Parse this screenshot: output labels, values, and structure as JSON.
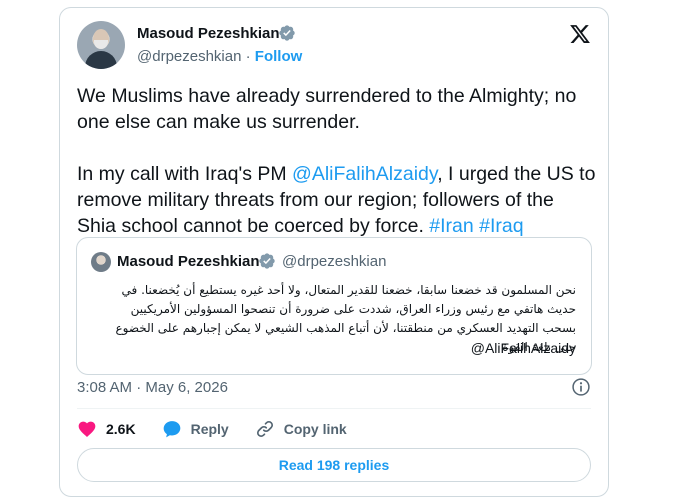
{
  "author": {
    "name": "Masoud Pezeshkian",
    "handle": "@drpezeshkian",
    "separator": "·",
    "follow_label": "Follow"
  },
  "tweet": {
    "paragraph1": "We Muslims have already surrendered to the Almighty; no one else can make us surrender.",
    "p2_before": "In my call with Iraq's PM ",
    "p2_mention": "@AliFalihAlzaidy",
    "p2_after": ", I urged the US to remove military threats from our region; followers of the Shia school cannot be coerced by force. ",
    "hashtag1": "#Iran",
    "hashtag2": "#Iraq"
  },
  "quote": {
    "name": "Masoud Pezeshkian",
    "handle": "@drpezeshkian",
    "text": "نحن المسلمون قد خضعنا سابقا، خضعنا للقدير المتعال، ولا أحد غيره يستطيع أن يُخضعنا. في حديث هاتفي مع رئيس وزراء العراق، شددت على ضرورة أن تنصحوا المسؤولين الأمريكيين بسحب التهديد العسكري من منطقتنا، لأن أتباع المذهب الشيعي لا يمكن إجبارهم على الخضوع حتى بلغة القوة",
    "mention": "@AliFalihAlzaidy"
  },
  "meta": {
    "timestamp": "3:08 AM · May 6, 2026"
  },
  "actions": {
    "likes": "2.6K",
    "reply_label": "Reply",
    "copy_link_label": "Copy link"
  },
  "read_replies_label": "Read 198 replies",
  "colors": {
    "accent": "#1d9bf0",
    "like": "#f91880",
    "text": "#0f1419",
    "muted": "#536471",
    "border": "#cfd9de"
  },
  "icons": [
    "verified-badge-icon",
    "x-logo-icon",
    "info-icon",
    "heart-icon",
    "reply-bubble-icon",
    "link-icon"
  ]
}
